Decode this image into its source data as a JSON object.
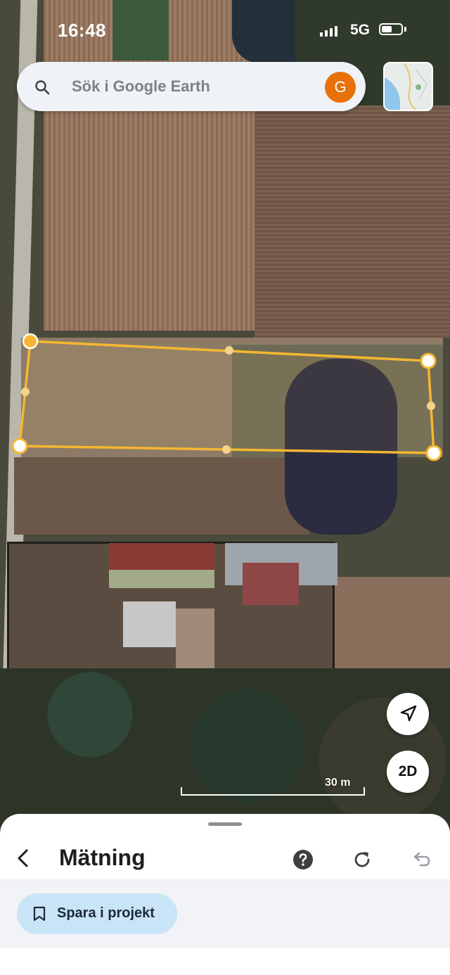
{
  "status_bar": {
    "time": "16:48",
    "network": "5G"
  },
  "search": {
    "placeholder": "Sök i Google Earth",
    "avatar_initial": "G"
  },
  "map": {
    "scale_label": "30 m",
    "view_mode_button": "2D"
  },
  "measurement": {
    "line_color": "#f5b731"
  },
  "sheet": {
    "title": "Mätning",
    "save_button_label": "Spara i projekt"
  },
  "icons": {
    "search": "search-icon",
    "locate": "navigation-arrow-icon",
    "back": "chevron-left-icon",
    "help": "help-circle-icon",
    "refresh": "refresh-icon",
    "undo": "undo-icon",
    "bookmark": "bookmark-icon"
  },
  "colors": {
    "accent": "#e8710a",
    "save_button_bg": "#c9e4f7"
  }
}
